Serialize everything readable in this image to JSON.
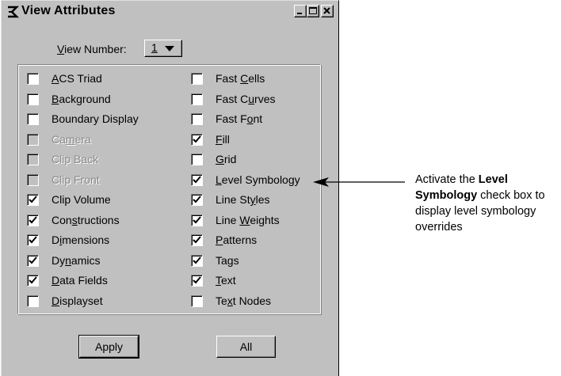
{
  "window": {
    "title": "View Attributes"
  },
  "view_number": {
    "label": "View Number:",
    "value": "1"
  },
  "options_left": [
    {
      "label": "ACS Triad",
      "checked": false,
      "disabled": false,
      "mnemonic": "A"
    },
    {
      "label": "Background",
      "checked": false,
      "disabled": false,
      "mnemonic": "B"
    },
    {
      "label": "Boundary Display",
      "checked": false,
      "disabled": false,
      "mnemonic": ""
    },
    {
      "label": "Camera",
      "checked": false,
      "disabled": true,
      "mnemonic": "m"
    },
    {
      "label": "Clip Back",
      "checked": false,
      "disabled": true,
      "mnemonic": ""
    },
    {
      "label": "Clip Front",
      "checked": false,
      "disabled": true,
      "mnemonic": ""
    },
    {
      "label": "Clip Volume",
      "checked": true,
      "disabled": false,
      "mnemonic": ""
    },
    {
      "label": "Constructions",
      "checked": true,
      "disabled": false,
      "mnemonic": "s"
    },
    {
      "label": "Dimensions",
      "checked": true,
      "disabled": false,
      "mnemonic": "i"
    },
    {
      "label": "Dynamics",
      "checked": true,
      "disabled": false,
      "mnemonic": "n"
    },
    {
      "label": "Data Fields",
      "checked": true,
      "disabled": false,
      "mnemonic": "D"
    },
    {
      "label": "Displayset",
      "checked": false,
      "disabled": false,
      "mnemonic": "D"
    }
  ],
  "options_right": [
    {
      "label": "Fast Cells",
      "checked": false,
      "disabled": false,
      "mnemonic": "C"
    },
    {
      "label": "Fast Curves",
      "checked": false,
      "disabled": false,
      "mnemonic": "u"
    },
    {
      "label": "Fast Font",
      "checked": false,
      "disabled": false,
      "mnemonic": "o"
    },
    {
      "label": "Fill",
      "checked": true,
      "disabled": false,
      "mnemonic": "F"
    },
    {
      "label": "Grid",
      "checked": false,
      "disabled": false,
      "mnemonic": "G"
    },
    {
      "label": "Level Symbology",
      "checked": true,
      "disabled": false,
      "mnemonic": "L"
    },
    {
      "label": "Line Styles",
      "checked": true,
      "disabled": false,
      "mnemonic": "y"
    },
    {
      "label": "Line Weights",
      "checked": true,
      "disabled": false,
      "mnemonic": "W"
    },
    {
      "label": "Patterns",
      "checked": true,
      "disabled": false,
      "mnemonic": "P"
    },
    {
      "label": "Tags",
      "checked": true,
      "disabled": false,
      "mnemonic": ""
    },
    {
      "label": "Text",
      "checked": true,
      "disabled": false,
      "mnemonic": "T"
    },
    {
      "label": "Text Nodes",
      "checked": false,
      "disabled": false,
      "mnemonic": "x"
    }
  ],
  "buttons": {
    "apply": "Apply",
    "all": "All"
  },
  "callout": {
    "pre": "Activate the ",
    "bold": "Level Symbology",
    "post": " check box to display level symbology overrides"
  },
  "colors": {
    "dialog_bg": "#c0c0c0",
    "disabled_text": "#8a8a8a"
  }
}
